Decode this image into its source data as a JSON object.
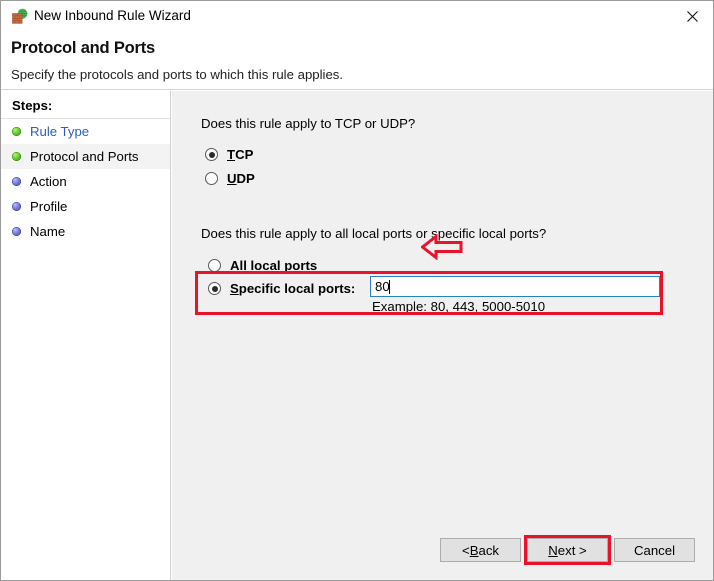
{
  "window": {
    "title": "New Inbound Rule Wizard",
    "app_icon": "firewall-brickwall-globe-icon",
    "close_label": "✕"
  },
  "header": {
    "title": "Protocol and Ports",
    "subtitle": "Specify the protocols and ports to which this rule applies."
  },
  "sidebar": {
    "heading": "Steps:",
    "items": [
      {
        "label": "Rule Type",
        "bullet": "green",
        "state": "completed-link"
      },
      {
        "label": "Protocol and Ports",
        "bullet": "green",
        "state": "current"
      },
      {
        "label": "Action",
        "bullet": "blue",
        "state": "upcoming"
      },
      {
        "label": "Profile",
        "bullet": "blue",
        "state": "upcoming"
      },
      {
        "label": "Name",
        "bullet": "blue",
        "state": "upcoming"
      }
    ]
  },
  "main": {
    "protocol_prompt": "Does this rule apply to TCP or UDP?",
    "protocol_options": [
      {
        "label": "TCP",
        "accelerator": "T",
        "rest": "CP",
        "selected": true
      },
      {
        "label": "UDP",
        "accelerator": "U",
        "rest": "DP",
        "selected": false
      }
    ],
    "ports_prompt": "Does this rule apply to all local ports or specific local ports?",
    "ports_options": [
      {
        "label": "All local ports",
        "accelerator": "A",
        "rest": "ll local ports",
        "selected": false
      },
      {
        "label": "Specific local ports:",
        "accelerator": "S",
        "rest": "pecific local ports:",
        "selected": true
      }
    ],
    "ports_value": "80",
    "ports_example": "Example: 80, 443, 5000-5010"
  },
  "footer": {
    "back": {
      "prefix": "< ",
      "accelerator": "B",
      "rest": "ack"
    },
    "next": {
      "accelerator": "N",
      "rest": "ext >"
    },
    "cancel": "Cancel"
  },
  "annotations": {
    "arrow_color": "#e8132b",
    "rect_color": "#e8132b",
    "arrow_target": "TCP radio option",
    "rect_targets": [
      "Specific local ports row",
      "Next button"
    ]
  },
  "colors": {
    "panel_background": "#f0f0f0",
    "sidebar_background": "#ffffff",
    "link": "#2e5fb5",
    "input_focus_border": "#2a7fc9",
    "annotation_red": "#e8132b"
  }
}
